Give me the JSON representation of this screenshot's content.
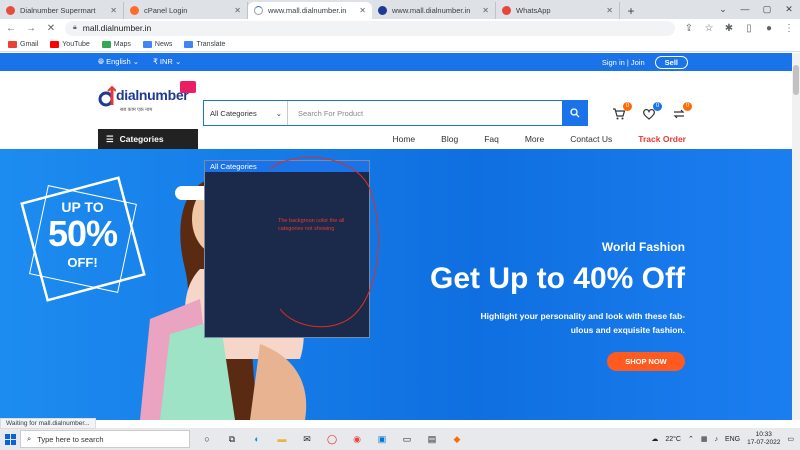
{
  "browser": {
    "tabs": [
      {
        "title": "Dialnumber Supermart",
        "fav": "#e84c3d"
      },
      {
        "title": "cPanel Login",
        "fav": "#ff6c2c"
      },
      {
        "title": "www.mall.dialnumber.in",
        "fav": "#9aa0a6",
        "active": true
      },
      {
        "title": "www.mall.dialnumber.in",
        "fav": "#1f3a93"
      },
      {
        "title": "WhatsApp",
        "fav": "#e8453c"
      }
    ],
    "url": "mall.dialnumber.in",
    "bookmarks": [
      {
        "label": "Gmail",
        "color": "#ea4335"
      },
      {
        "label": "YouTube",
        "color": "#ff0000"
      },
      {
        "label": "Maps",
        "color": "#34a853"
      },
      {
        "label": "News",
        "color": "#4285f4"
      },
      {
        "label": "Translate",
        "color": "#4285f4"
      }
    ],
    "status": "Waiting for mall.dialnumber..."
  },
  "site": {
    "language": "English",
    "currency": "₹ INR",
    "signin": "Sign in | Join",
    "sell": "Sell",
    "logo_text": "dialnumber",
    "logo_sub": "सब काम एक नाम",
    "search": {
      "category": "All Categories",
      "placeholder": "Search For Product"
    },
    "badges": {
      "cart": "0",
      "wishlist": "0",
      "compare": "0"
    },
    "categories_label": "Categories",
    "nav": [
      "Home",
      "Blog",
      "Faq",
      "More",
      "Contact Us"
    ],
    "track_order": "Track Order",
    "dropdown": {
      "selected": "All Categories",
      "note": "The backgroun color the all categories not showing"
    },
    "hero": {
      "promo_up": "UP TO",
      "promo_pct": "50%",
      "promo_off": "OFF!",
      "subtitle": "World Fashion",
      "title": "Get Up to 40% Off",
      "desc1": "Highlight your personality and look with these fab-",
      "desc2": "ulous and exquisite fashion.",
      "button": "SHOP NOW"
    }
  },
  "taskbar": {
    "search_placeholder": "Type here to search",
    "temp": "22°C",
    "lang": "ENG",
    "time": "10:33",
    "date": "17-07-2022"
  },
  "colors": {
    "primary": "#1a73e8",
    "accent": "#ff5a1f",
    "dropdown_bg": "#1b2a4a",
    "track": "#e53935"
  }
}
